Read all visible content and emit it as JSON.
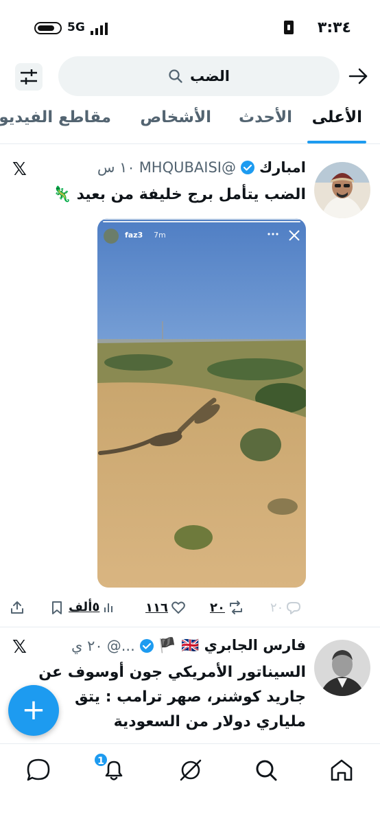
{
  "status_bar": {
    "time": "٣:٣٤",
    "network": "5G"
  },
  "search": {
    "query": "الضب"
  },
  "tabs": [
    {
      "label": "الأعلى"
    },
    {
      "label": "الأحدث"
    },
    {
      "label": "الأشخاص"
    },
    {
      "label": "مقاطع الفيديو"
    }
  ],
  "posts": [
    {
      "author": "امبارك",
      "handle": "@MHQUBAISI",
      "time": "١٠ س",
      "text": "الضب يتأمل برج خليفة من بعيد 🦎",
      "story": {
        "user": "faz3",
        "age": "7m"
      },
      "actions": {
        "replies": "٢٠",
        "reposts": "٢٠",
        "likes": "١١٦",
        "views": "٥ألف"
      }
    },
    {
      "author": "فارس الجابري 🇬🇧 🏴",
      "handle": "...@",
      "time": "٢٠ ي",
      "text_lines": [
        "السيناتور الأمريكي جون أوسوف عن",
        "جاريد كوشنر، صهر ترامب : يتق",
        "ملياري دولار من السعودية"
      ]
    }
  ],
  "fab": {
    "label": "+"
  },
  "notifications_badge": "1",
  "colors": {
    "accent": "#1d9bf0",
    "text": "#0f1419",
    "muted": "#536471"
  }
}
